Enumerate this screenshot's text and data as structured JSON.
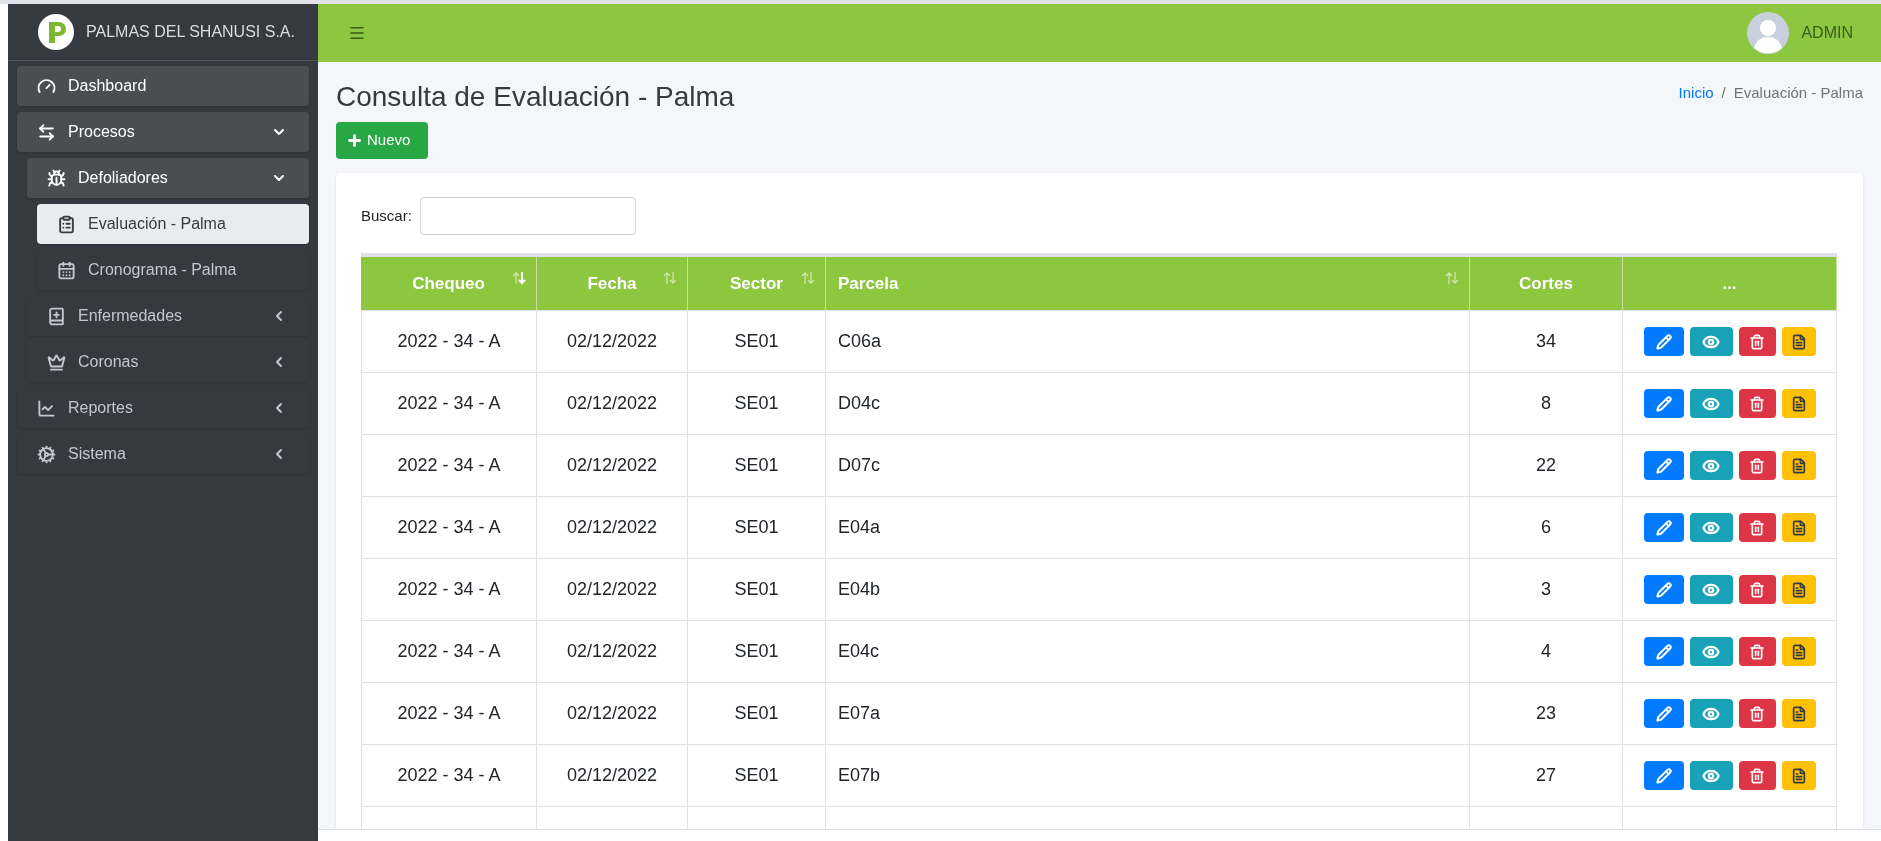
{
  "brand": {
    "name": "PALMAS DEL SHANUSI S.A."
  },
  "sidebar": {
    "items": [
      {
        "kind": "gauge",
        "label": "Dashboard",
        "selected": false
      },
      {
        "kind": "arrows",
        "label": "Procesos",
        "selected": false,
        "expanded": true,
        "children": [
          {
            "kind": "bug",
            "label": "Defoliadores",
            "selected": false,
            "expanded": true,
            "children": [
              {
                "kind": "clipboard",
                "label": "Evaluación - Palma",
                "selected": true
              },
              {
                "kind": "calendar",
                "label": "Cronograma - Palma",
                "selected": false
              }
            ]
          },
          {
            "kind": "book",
            "label": "Enfermedades",
            "selected": false,
            "expanded": false
          },
          {
            "kind": "crown",
            "label": "Coronas",
            "selected": false,
            "expanded": false
          }
        ]
      },
      {
        "kind": "chart",
        "label": "Reportes",
        "selected": false,
        "expanded": false
      },
      {
        "kind": "cogs",
        "label": "Sistema",
        "selected": false,
        "expanded": false
      }
    ]
  },
  "header": {
    "user": "ADMIN"
  },
  "page": {
    "title": "Consulta de Evaluación - Palma",
    "new_button": "Nuevo"
  },
  "breadcrumb": [
    {
      "label": "Inicio",
      "kind": "link"
    },
    {
      "label": "Evaluación - Palma",
      "kind": "current",
      "separator": "/"
    }
  ],
  "search": {
    "label": "Buscar:"
  },
  "table": {
    "columns": [
      {
        "label": "Chequeo",
        "sorted": true
      },
      {
        "label": "Fecha",
        "sorted": false
      },
      {
        "label": "Sector",
        "sorted": false
      },
      {
        "label": "Parcela",
        "sorted": false
      },
      {
        "label": "Cortes"
      },
      {
        "label": "..."
      }
    ],
    "rows": [
      [
        "2022 - 34 - A",
        "02/12/2022",
        "SE01",
        "C06a",
        "34"
      ],
      [
        "2022 - 34 - A",
        "02/12/2022",
        "SE01",
        "D04c",
        "8"
      ],
      [
        "2022 - 34 - A",
        "02/12/2022",
        "SE01",
        "D07c",
        "22"
      ],
      [
        "2022 - 34 - A",
        "02/12/2022",
        "SE01",
        "E04a",
        "6"
      ],
      [
        "2022 - 34 - A",
        "02/12/2022",
        "SE01",
        "E04b",
        "3"
      ],
      [
        "2022 - 34 - A",
        "02/12/2022",
        "SE01",
        "E04c",
        "4"
      ],
      [
        "2022 - 34 - A",
        "02/12/2022",
        "SE01",
        "E07a",
        "23"
      ],
      [
        "2022 - 34 - A",
        "02/12/2022",
        "SE01",
        "E07b",
        "27"
      ]
    ]
  }
}
